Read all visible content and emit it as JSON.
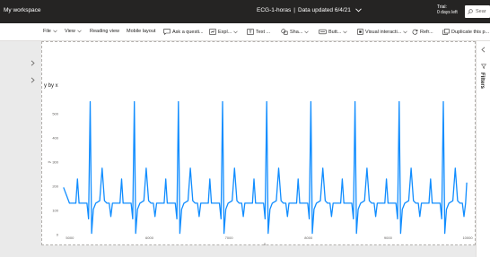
{
  "topbar": {
    "workspace": "My workspace",
    "report_title": "ECG-1-horas",
    "separator": "|",
    "data_updated": "Data updated 6/4/21",
    "trial_line1": "Trial:",
    "trial_line2": "0 days left",
    "search_placeholder": "Sear"
  },
  "commandbar": {
    "items": [
      {
        "label": "File",
        "icon": "",
        "chevron": true
      },
      {
        "label": "View",
        "icon": "",
        "chevron": true
      },
      {
        "label": "Reading view",
        "icon": "",
        "chevron": false
      },
      {
        "label": "Mobile layout",
        "icon": "",
        "chevron": false
      },
      {
        "label": "Ask a questi...",
        "icon": "chat-icon",
        "chevron": false
      },
      {
        "label": "Expl...",
        "icon": "explore-icon",
        "chevron": true
      },
      {
        "label": "Text ...",
        "icon": "textbox-icon",
        "chevron": false
      },
      {
        "label": "Sha...",
        "icon": "shapes-icon",
        "chevron": true
      },
      {
        "label": "Butt...",
        "icon": "buttons-icon",
        "chevron": true
      },
      {
        "label": "Visual interacti...",
        "icon": "visual-interactions-icon",
        "chevron": true
      },
      {
        "label": "Refr...",
        "icon": "refresh-icon",
        "chevron": false
      },
      {
        "label": "Duplicate this p...",
        "icon": "duplicate-icon",
        "chevron": false
      }
    ]
  },
  "filters_pane": {
    "label": "Filters"
  },
  "visual": {
    "title": "y by x"
  },
  "chart_data": {
    "type": "line",
    "title": "y by x",
    "xlabel": "x",
    "ylabel": "y",
    "xlim": [
      4900,
      10000
    ],
    "ylim": [
      0,
      600
    ],
    "xticks": [
      5000,
      6000,
      7000,
      8000,
      9000,
      10000
    ],
    "yticks": [
      0,
      100,
      200,
      300,
      400,
      500
    ],
    "grid": false,
    "color": "#118dff",
    "beat_times": [
      5255,
      5810,
      6365,
      6920,
      7475,
      8030,
      8585,
      9140,
      9695
    ],
    "beat_shape": [
      {
        "dt": -260,
        "y": 130
      },
      {
        "dt": -180,
        "y": 130
      },
      {
        "dt": -160,
        "y": 230
      },
      {
        "dt": -140,
        "y": 130
      },
      {
        "dt": -40,
        "y": 130
      },
      {
        "dt": -20,
        "y": 65
      },
      {
        "dt": 0,
        "y": 550
      },
      {
        "dt": 18,
        "y": 5
      },
      {
        "dt": 40,
        "y": 105
      },
      {
        "dt": 70,
        "y": 130
      },
      {
        "dt": 120,
        "y": 140
      },
      {
        "dt": 150,
        "y": 275
      },
      {
        "dt": 180,
        "y": 140
      },
      {
        "dt": 210,
        "y": 130
      },
      {
        "dt": 240,
        "y": 130
      },
      {
        "dt": 260,
        "y": 75
      },
      {
        "dt": 280,
        "y": 130
      }
    ],
    "series_start": {
      "x": 4920,
      "y": 195
    },
    "series_end": {
      "x": 9990,
      "y": 215
    }
  }
}
